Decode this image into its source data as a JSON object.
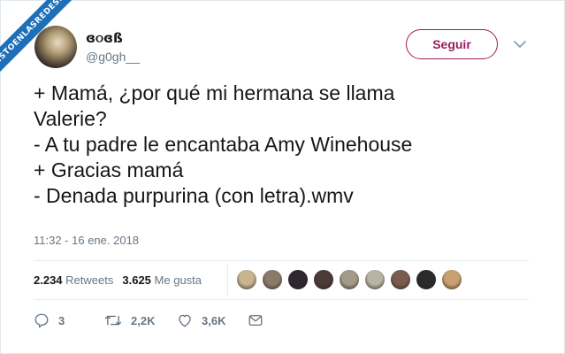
{
  "watermark": {
    "text": "VISTOENLASREDES.COM"
  },
  "author": {
    "display_name": "ɞ૦ɞß",
    "handle": "@g0gh__"
  },
  "follow_button": {
    "label": "Seguir",
    "color": "#9b1d5c"
  },
  "tweet": {
    "lines": [
      "+ Mamá, ¿por qué mi hermana se llama",
      "Valerie?",
      "- A tu padre le encantaba Amy Winehouse",
      "+ Gracias mamá",
      "- Denada purpurina (con letra).wmv"
    ]
  },
  "timestamp": "11:32 - 16 ene. 2018",
  "stats": {
    "retweets_count": "2.234",
    "retweets_label": "Retweets",
    "likes_count": "3.625",
    "likes_label": "Me gusta"
  },
  "liker_avatar_colors": [
    "#c8b48f",
    "#8a7a6a",
    "#2e2630",
    "#4a3a38",
    "#a49a88",
    "#b9b3a5",
    "#7a5c4f",
    "#2a2a2a",
    "#c9a070"
  ],
  "actions": {
    "replies": "3",
    "retweets": "2,2K",
    "likes": "3,6K"
  },
  "colors": {
    "text": "#14171a",
    "secondary": "#657786",
    "border": "#e6ecf0"
  }
}
